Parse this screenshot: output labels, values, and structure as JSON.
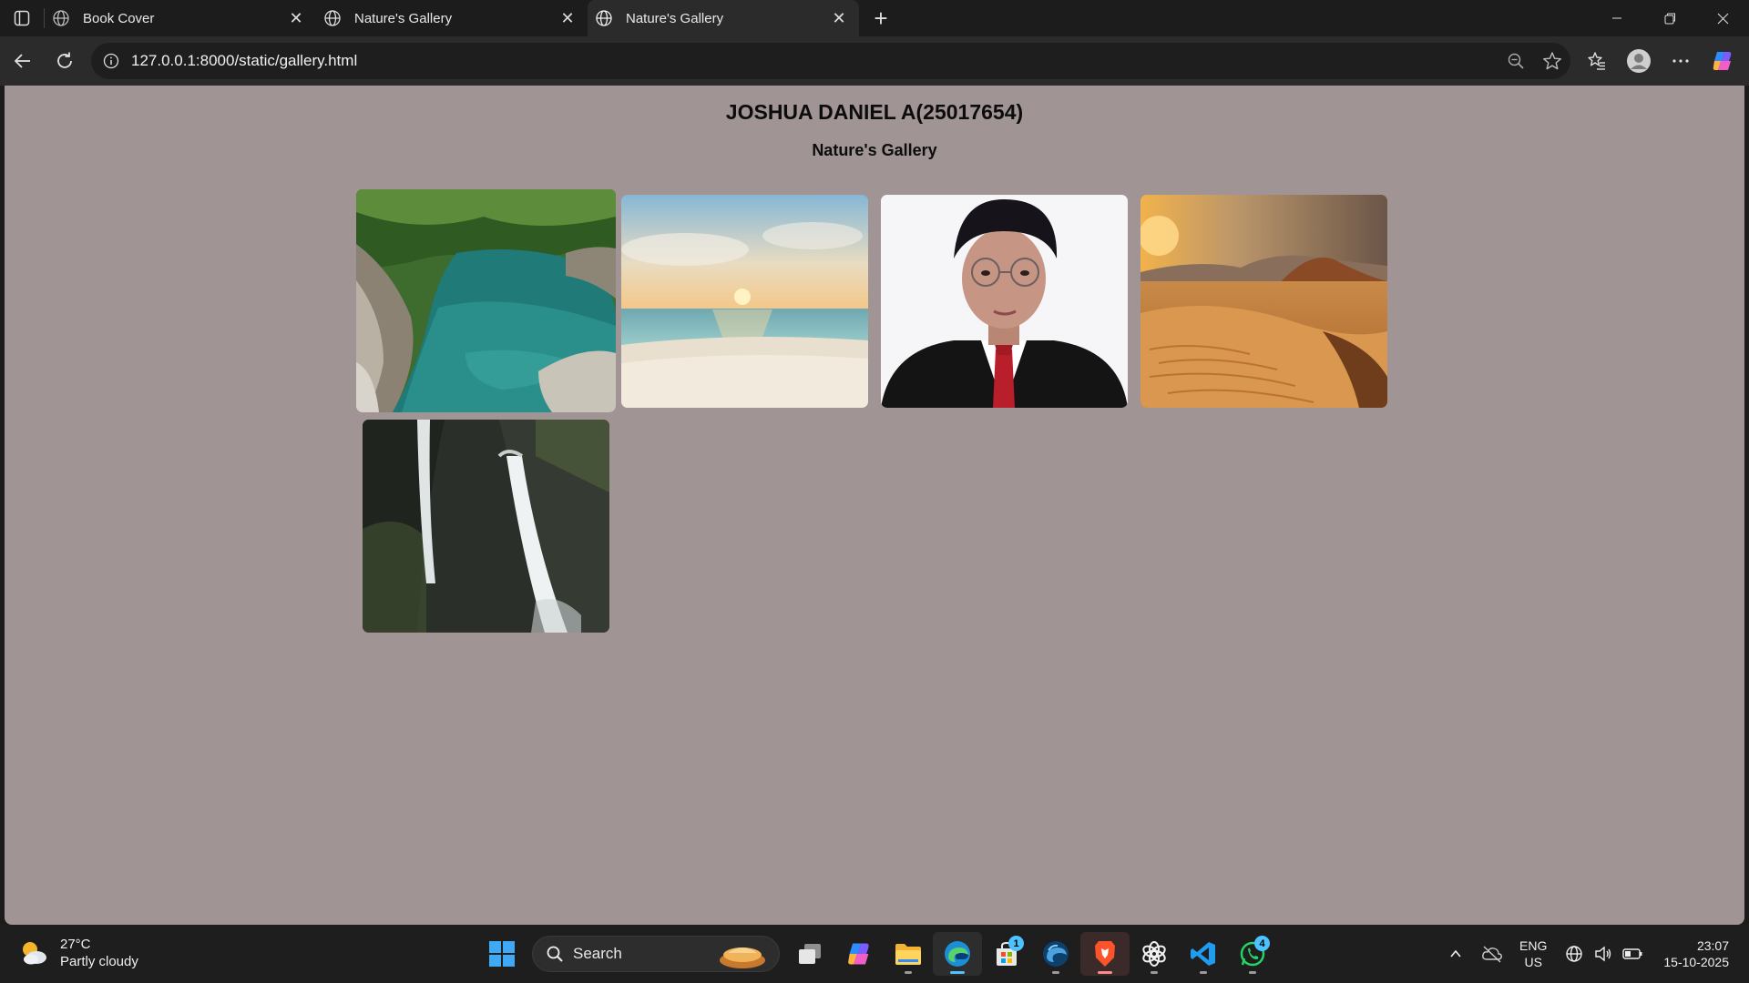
{
  "browser": {
    "tabs": [
      {
        "title": "Book Cover",
        "active": false
      },
      {
        "title": "Nature's Gallery",
        "active": false
      },
      {
        "title": "Nature's Gallery",
        "active": true
      }
    ],
    "url": "127.0.0.1:8000/static/gallery.html",
    "new_tab_glyph": "+",
    "close_glyph": "✕"
  },
  "page": {
    "heading": "JOSHUA DANIEL A(25017654)",
    "subheading": "Nature's Gallery",
    "background": "#a09494",
    "images": [
      {
        "subject": "river-in-forest"
      },
      {
        "subject": "beach-sunset"
      },
      {
        "subject": "portrait"
      },
      {
        "subject": "desert-dunes"
      },
      {
        "subject": "waterfall"
      }
    ]
  },
  "taskbar": {
    "weather": {
      "temp": "27°C",
      "condition": "Partly cloudy"
    },
    "search_label": "Search",
    "apps": [
      "task-view",
      "copilot",
      "file-explorer",
      "edge",
      "microsoft-store",
      "edge-dev",
      "brave",
      "chatgpt",
      "vscode",
      "whatsapp"
    ],
    "store_badge": "1",
    "whatsapp_badge": "4",
    "lang_top": "ENG",
    "lang_bottom": "US",
    "time": "23:07",
    "date": "15-10-2025"
  }
}
